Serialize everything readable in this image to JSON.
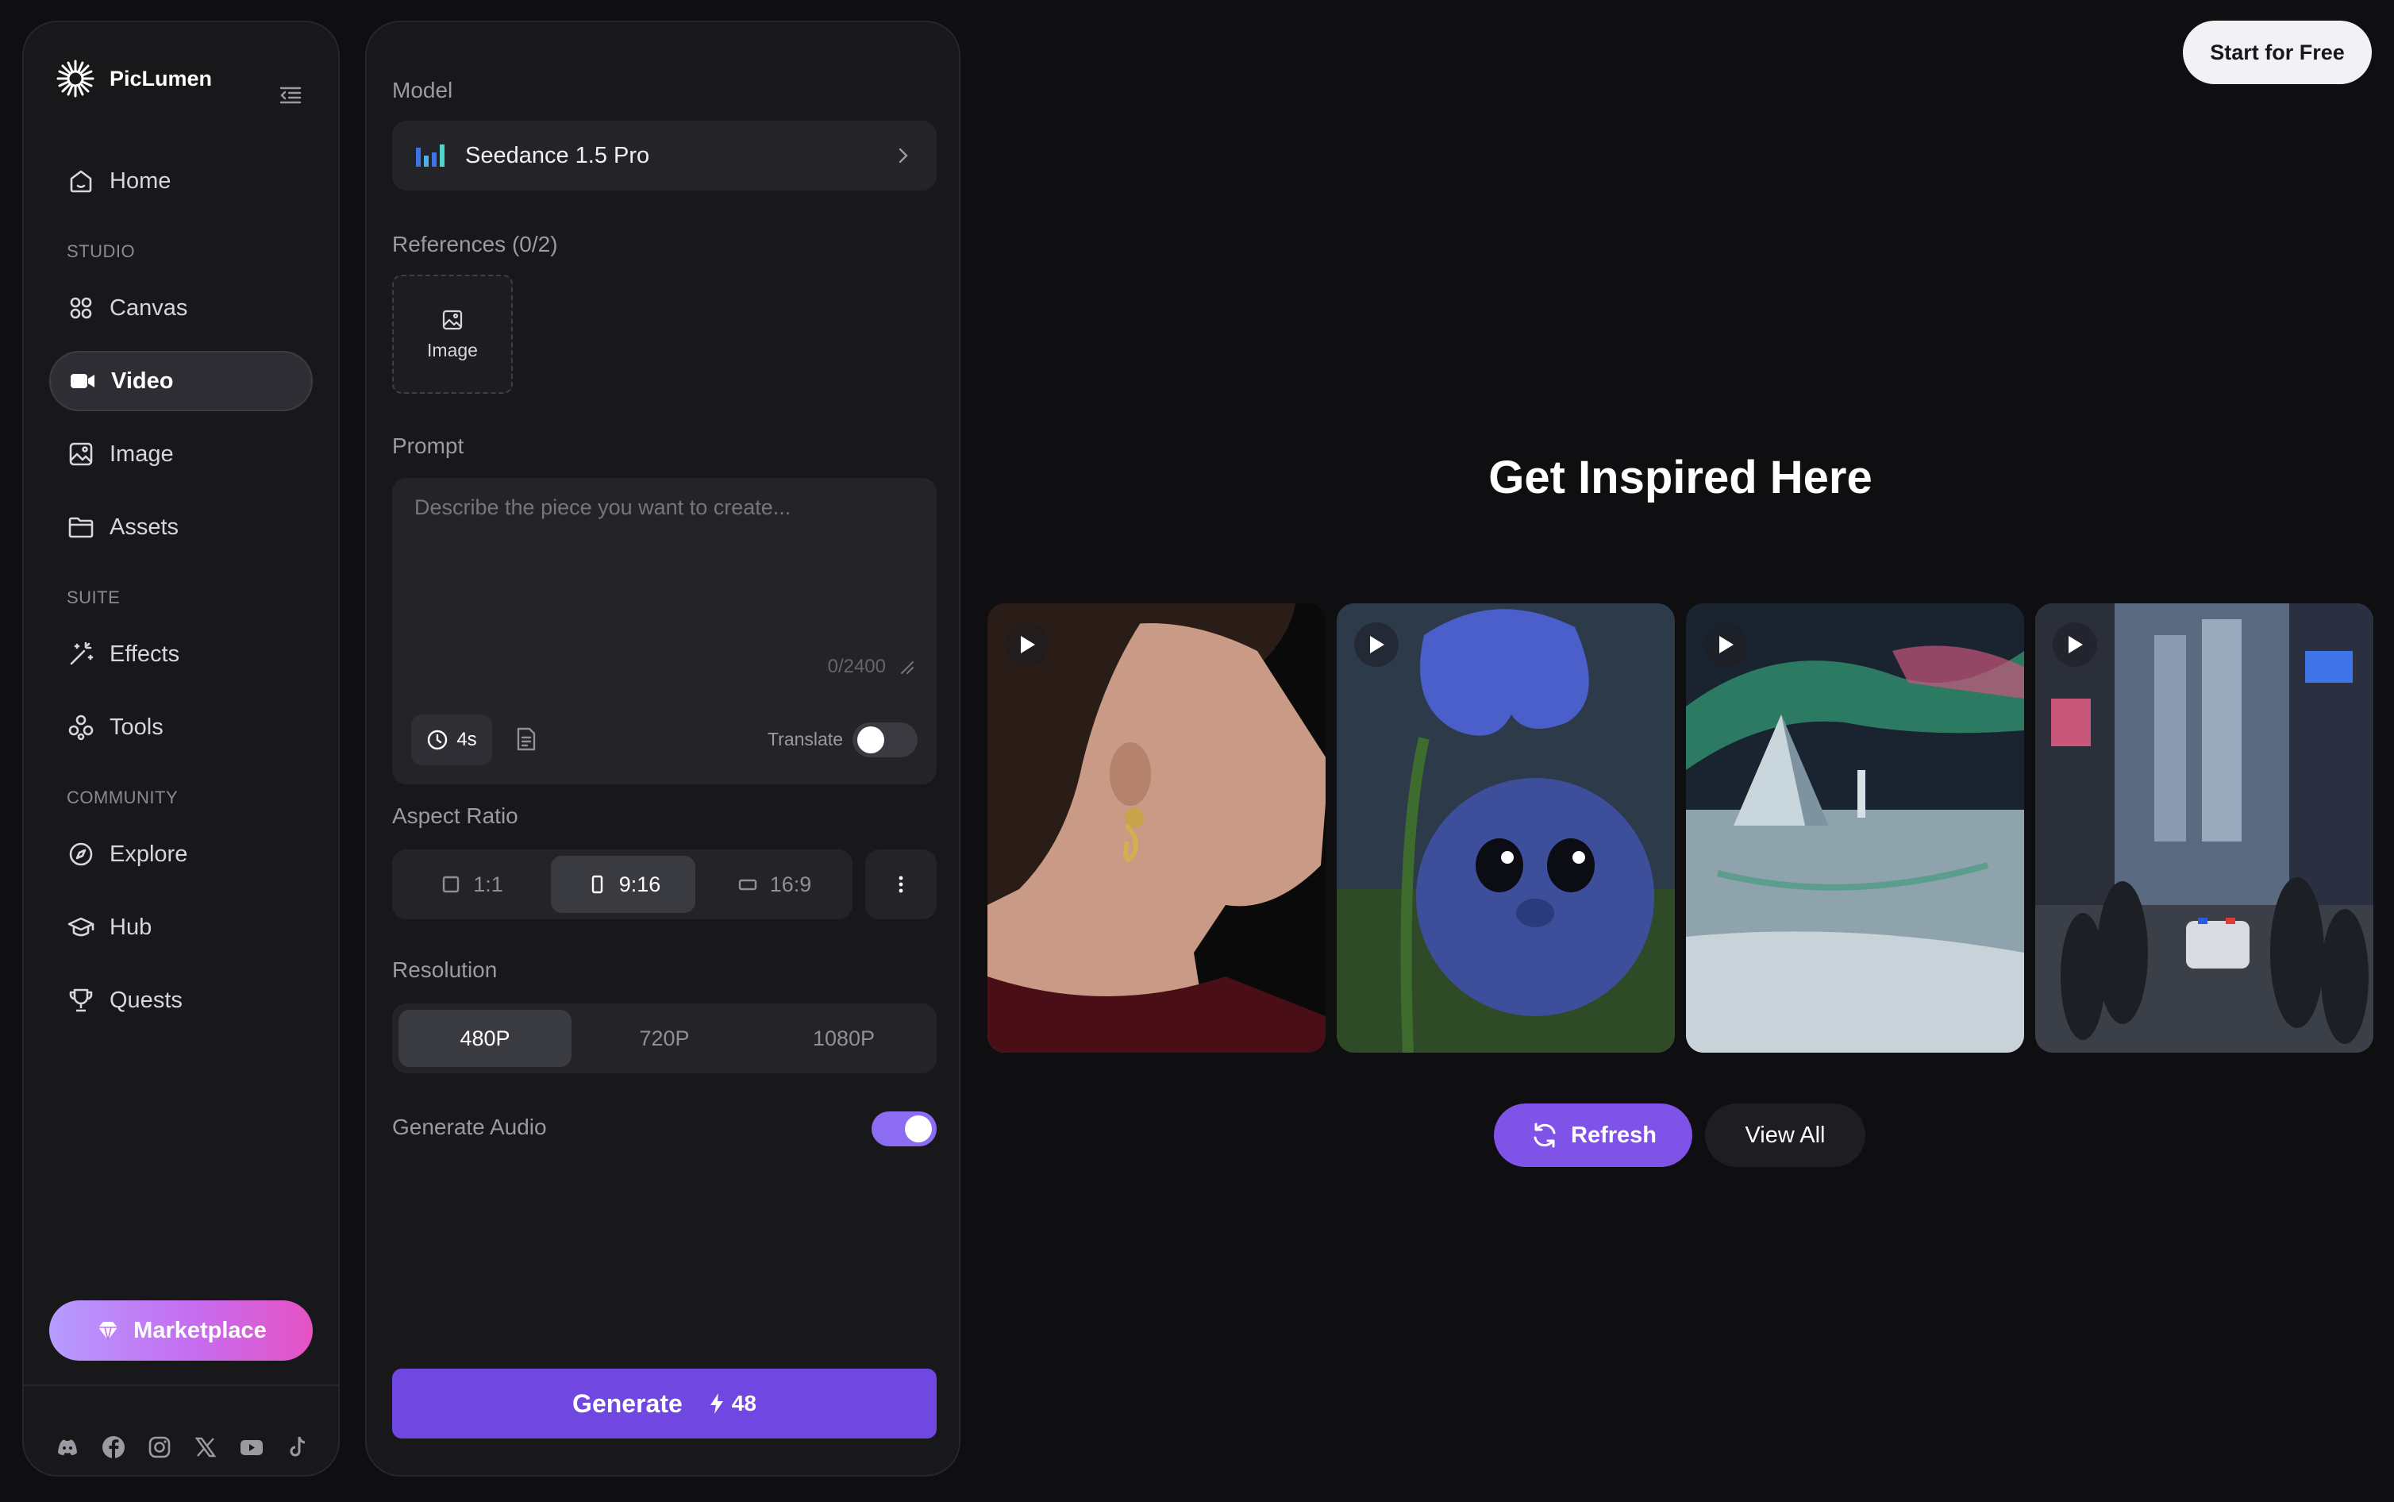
{
  "brand": {
    "name": "PicLumen"
  },
  "sidebar": {
    "items": [
      {
        "label": "Home",
        "icon": "home-icon"
      },
      {
        "label": "Canvas",
        "icon": "canvas-icon"
      },
      {
        "label": "Video",
        "icon": "video-icon",
        "active": true
      },
      {
        "label": "Image",
        "icon": "image-icon"
      },
      {
        "label": "Assets",
        "icon": "folder-icon"
      },
      {
        "label": "Effects",
        "icon": "magic-wand-icon"
      },
      {
        "label": "Tools",
        "icon": "tools-icon"
      },
      {
        "label": "Explore",
        "icon": "compass-icon"
      },
      {
        "label": "Hub",
        "icon": "graduation-cap-icon"
      },
      {
        "label": "Quests",
        "icon": "trophy-icon"
      }
    ],
    "sections": {
      "studio": "STUDIO",
      "suite": "SUITE",
      "community": "COMMUNITY"
    },
    "marketplace_label": "Marketplace",
    "socials": [
      "discord-icon",
      "facebook-icon",
      "instagram-icon",
      "x-icon",
      "youtube-icon",
      "tiktok-icon"
    ]
  },
  "panel": {
    "model_label": "Model",
    "model_name": "Seedance 1.5 Pro",
    "references_label": "References (0/2)",
    "reference_button": "Image",
    "prompt_label": "Prompt",
    "prompt_placeholder": "Describe the piece you want to create...",
    "prompt_value": "",
    "prompt_counter": "0/2400",
    "duration": "4s",
    "translate_label": "Translate",
    "translate_on": false,
    "aspect_label": "Aspect Ratio",
    "aspect_options": [
      "1:1",
      "9:16",
      "16:9"
    ],
    "aspect_selected": "9:16",
    "resolution_label": "Resolution",
    "resolution_options": [
      "480P",
      "720P",
      "1080P"
    ],
    "resolution_selected": "480P",
    "audio_label": "Generate Audio",
    "audio_on": true,
    "generate_label": "Generate",
    "generate_credits": "48"
  },
  "header": {
    "start_free": "Start for Free"
  },
  "main": {
    "title": "Get Inspired Here",
    "refresh_label": "Refresh",
    "view_all_label": "View All"
  },
  "colors": {
    "accent": "#7047e0",
    "refresh": "#7f52e8",
    "toggle_on": "#8c6cf0"
  }
}
